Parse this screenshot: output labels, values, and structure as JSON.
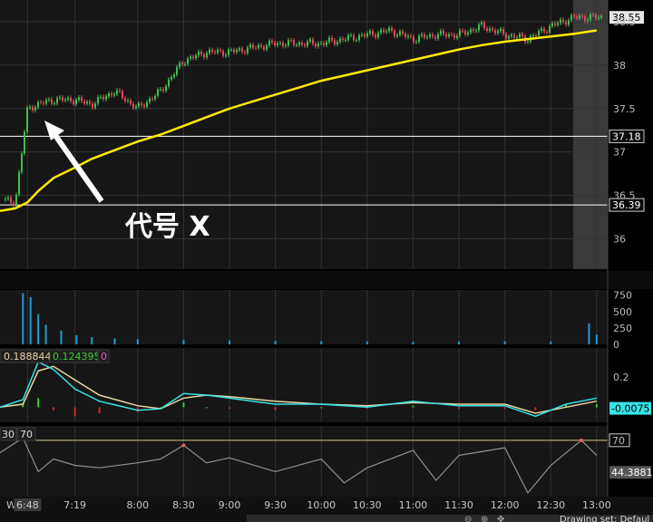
{
  "colors": {
    "background": "#000000",
    "panel": "#1a1a1a",
    "grid": "#333333",
    "candle_up": "#3fbf4f",
    "candle_down": "#e0475a",
    "vwap": "#ffeb00",
    "volume": "#1f9ad6",
    "macd_line": "#35e4e6",
    "signal_line": "#e8d6a4",
    "hist_pos": "#35d035",
    "hist_neg": "#e02020",
    "rsi": "#909090",
    "rsi_ob": "#e06060",
    "level": "#ffffff",
    "extended_shade": "#3a3a3a",
    "badge_bg": "#e6e6e6",
    "badge_text": "#000000",
    "annotation": "#ffffff"
  },
  "chart_data": [
    {
      "type": "line",
      "panel": "price",
      "subtype": "candlestick",
      "x": [
        "6:30",
        "6:40",
        "6:48",
        "6:55",
        "7:05",
        "7:19",
        "7:30",
        "7:45",
        "8:00",
        "8:15",
        "8:30",
        "8:45",
        "9:00",
        "9:15",
        "9:30",
        "9:45",
        "10:00",
        "10:15",
        "10:30",
        "10:45",
        "11:00",
        "11:15",
        "11:30",
        "11:45",
        "12:00",
        "12:15",
        "12:30",
        "12:45",
        "13:00"
      ],
      "series": [
        {
          "values": [
            36.45,
            36.42,
            37.5,
            37.55,
            37.6,
            37.6,
            37.55,
            37.7,
            37.5,
            37.7,
            38.05,
            38.15,
            38.15,
            38.2,
            38.25,
            38.25,
            38.25,
            38.3,
            38.35,
            38.4,
            38.3,
            38.35,
            38.35,
            38.45,
            38.35,
            38.3,
            38.45,
            38.55,
            38.55
          ]
        },
        {
          "values": [
            36.32,
            36.35,
            36.42,
            36.55,
            36.7,
            36.82,
            36.92,
            37.02,
            37.12,
            37.2,
            37.3,
            37.4,
            37.5,
            37.58,
            37.66,
            37.74,
            37.82,
            37.88,
            37.94,
            38.0,
            38.06,
            38.12,
            38.18,
            38.23,
            38.27,
            38.3,
            38.33,
            38.36,
            38.4
          ]
        }
      ],
      "ylim": [
        35.65,
        38.75
      ],
      "yticks": [
        "36",
        "36.5",
        "37",
        "37.5",
        "38",
        "38.5"
      ],
      "levels": [
        {
          "label": "37.18",
          "value": 37.18
        },
        {
          "label": "36.39",
          "value": 36.39
        }
      ],
      "last_label": "38.55"
    },
    {
      "type": "bar",
      "panel": "volume",
      "x": [
        "6:45",
        "6:50",
        "6:55",
        "7:00",
        "7:10",
        "7:20",
        "7:30",
        "7:45",
        "8:00",
        "8:30",
        "9:00",
        "9:30",
        "10:00",
        "10:30",
        "11:00",
        "11:30",
        "12:00",
        "12:30",
        "12:55",
        "13:00"
      ],
      "values": [
        780,
        720,
        460,
        300,
        210,
        140,
        110,
        90,
        80,
        70,
        60,
        55,
        50,
        45,
        40,
        45,
        50,
        45,
        320,
        150
      ],
      "ylim": [
        0,
        800
      ],
      "yticks": [
        "0",
        "250",
        "500",
        "750"
      ]
    },
    {
      "type": "line",
      "panel": "macd",
      "header": [
        "0.188844",
        "0.124395",
        "0"
      ],
      "x": [
        "6:30",
        "6:45",
        "6:55",
        "7:05",
        "7:19",
        "7:35",
        "8:00",
        "8:15",
        "8:30",
        "8:45",
        "9:00",
        "9:30",
        "10:00",
        "10:30",
        "11:00",
        "11:30",
        "12:00",
        "12:20",
        "12:40",
        "13:00"
      ],
      "series": [
        {
          "values": [
            0.0,
            0.05,
            0.3,
            0.25,
            0.12,
            0.04,
            -0.02,
            -0.01,
            0.09,
            0.08,
            0.06,
            0.02,
            0.02,
            0.0,
            0.04,
            0.01,
            0.01,
            -0.06,
            0.02,
            0.06
          ]
        },
        {
          "values": [
            0.0,
            0.02,
            0.24,
            0.27,
            0.18,
            0.08,
            0.01,
            -0.01,
            0.06,
            0.08,
            0.07,
            0.04,
            0.02,
            0.01,
            0.03,
            0.02,
            0.02,
            -0.04,
            0.0,
            0.04
          ]
        }
      ],
      "ylim": [
        -0.1,
        0.38
      ],
      "yticks": [
        "0.2"
      ],
      "last_label": "-0.0075"
    },
    {
      "type": "line",
      "panel": "rsi",
      "header": [
        "30",
        "70"
      ],
      "x": [
        "6:30",
        "6:45",
        "6:55",
        "7:05",
        "7:19",
        "7:35",
        "8:00",
        "8:15",
        "8:30",
        "8:45",
        "9:00",
        "9:30",
        "10:00",
        "10:15",
        "10:30",
        "11:00",
        "11:15",
        "11:30",
        "12:00",
        "12:15",
        "12:30",
        "12:50",
        "13:00"
      ],
      "series": [
        {
          "values": [
            60,
            72,
            45,
            55,
            50,
            48,
            52,
            55,
            66,
            52,
            56,
            45,
            55,
            36,
            48,
            62,
            38,
            58,
            64,
            28,
            50,
            70,
            58
          ]
        }
      ],
      "ylim": [
        25,
        80
      ],
      "yticks": [
        "70"
      ],
      "levels": [
        {
          "label": "70",
          "value": 70
        }
      ],
      "last_label": "44.3881"
    }
  ],
  "xaxis": {
    "ticks": [
      "6:48",
      "7:19",
      "8:00",
      "8:30",
      "9:00",
      "9:30",
      "10:00",
      "10:30",
      "11:00",
      "11:30",
      "12:00",
      "12:30",
      "13:00"
    ],
    "day": "Wed"
  },
  "annotation": {
    "text": "代号 X"
  },
  "drawing_set": "Drawing set: Defaul"
}
